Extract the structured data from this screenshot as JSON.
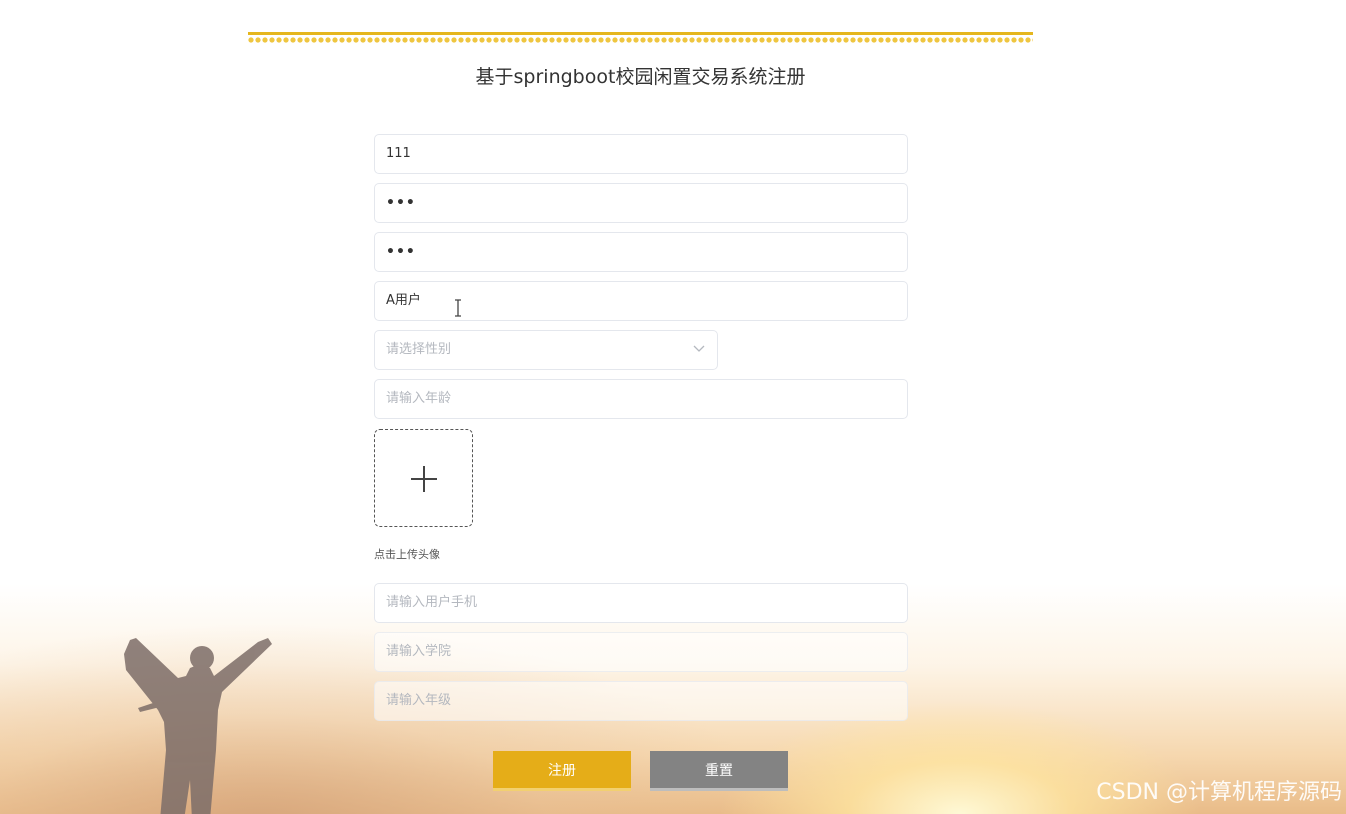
{
  "page": {
    "title": "基于springboot校园闲置交易系统注册"
  },
  "form": {
    "username_value": "111",
    "password_value": "•••",
    "confirm_password_value": "•••",
    "name_value": "A用户",
    "gender_placeholder": "请选择性别",
    "age_placeholder": "请输入年龄",
    "avatar_upload_label": "点击上传头像",
    "phone_placeholder": "请输入用户手机",
    "college_placeholder": "请输入学院",
    "grade_placeholder": "请输入年级"
  },
  "buttons": {
    "register_label": "注册",
    "reset_label": "重置"
  },
  "watermark": "CSDN @计算机程序源码",
  "colors": {
    "accent": "#e5ad18",
    "reset_button": "#838383",
    "fringe": "#e5b61d"
  },
  "icons": {
    "dropdown": "chevron-down-icon",
    "upload": "plus-icon",
    "cursor": "text-cursor-icon"
  }
}
